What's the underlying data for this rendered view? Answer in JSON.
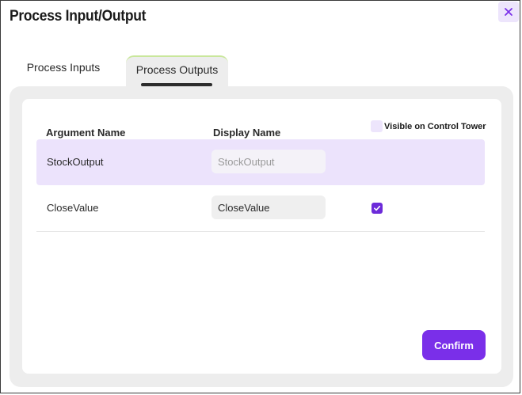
{
  "dialog": {
    "title": "Process Input/Output",
    "close_icon": "close-icon"
  },
  "tabs": [
    {
      "label": "Process Inputs",
      "active": false
    },
    {
      "label": "Process Outputs",
      "active": true
    }
  ],
  "table": {
    "headers": {
      "argument": "Argument Name",
      "display": "Display Name",
      "visible": "Visible on Control Tower"
    },
    "rows": [
      {
        "argument": "StockOutput",
        "display_value": "StockOutput",
        "editable": false,
        "visible_checked": false,
        "highlighted": true
      },
      {
        "argument": "CloseValue",
        "display_value": "CloseValue",
        "editable": true,
        "visible_checked": true,
        "highlighted": false
      }
    ]
  },
  "footer": {
    "confirm_label": "Confirm"
  },
  "colors": {
    "accent": "#7a2fe9",
    "highlight_row": "#ece3fc",
    "tab_indicator": "#c9e79b"
  }
}
